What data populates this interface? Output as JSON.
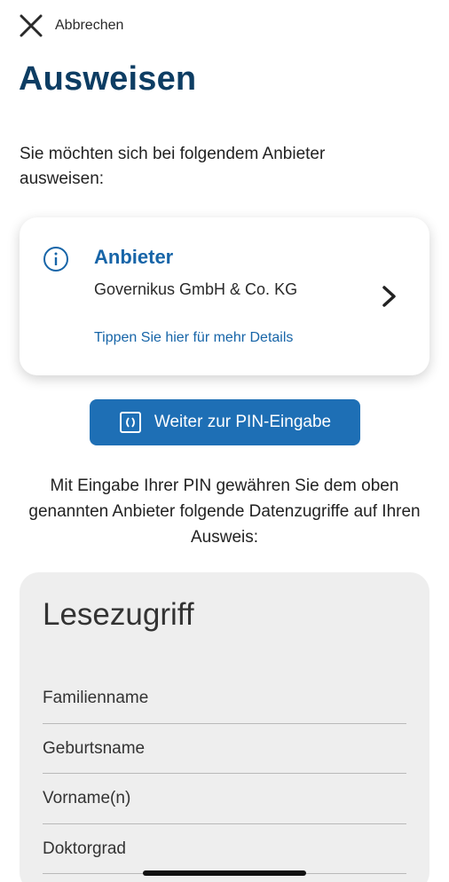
{
  "header": {
    "cancel_label": "Abbrechen",
    "title": "Ausweisen"
  },
  "intro": "Sie möchten sich bei folgendem Anbieter ausweisen:",
  "provider_card": {
    "title": "Anbieter",
    "name": "Governikus GmbH & Co. KG",
    "details_link": "Tippen Sie hier für mehr Details"
  },
  "pin_button": {
    "label": "Weiter zur PIN-Eingabe"
  },
  "access_info": "Mit Eingabe Ihrer PIN gewähren Sie dem oben genannten Anbieter folgende Datenzugriffe auf Ihren Ausweis:",
  "read_access": {
    "title": "Lesezugriff",
    "fields": [
      "Familienname",
      "Geburtsname",
      "Vorname(n)",
      "Doktorgrad"
    ]
  },
  "colors": {
    "title": "#0d3d63",
    "accent": "#1765a8",
    "button": "#1e6fb5"
  },
  "icons": {
    "cancel": "close-icon",
    "info": "info-icon",
    "chevron": "chevron-right-icon",
    "pin": "pin-entry-icon"
  }
}
